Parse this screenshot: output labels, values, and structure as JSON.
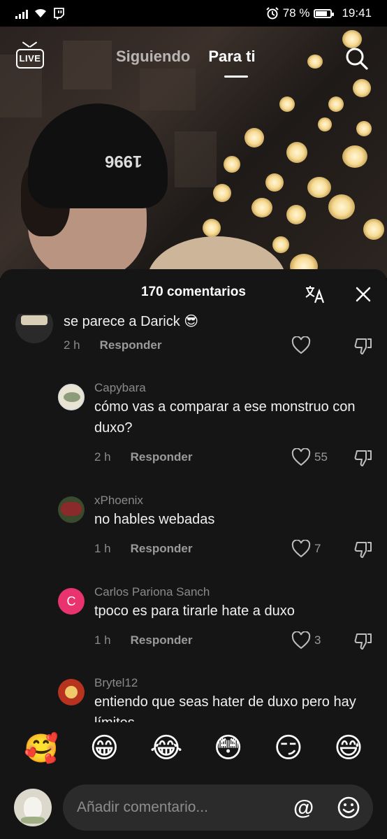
{
  "status_bar": {
    "battery": "78 %",
    "time": "19:41",
    "battery_level": 0.78
  },
  "top_nav": {
    "live_label": "LIVE",
    "tabs": [
      {
        "label": "Siguiendo",
        "active": false
      },
      {
        "label": "Para ti",
        "active": true
      }
    ]
  },
  "video": {
    "hat_text": "1996"
  },
  "comments_panel": {
    "title": "170 comentarios",
    "comments": [
      {
        "user": "",
        "text": "se parece a Darick 😎",
        "time": "2 h",
        "reply": "Responder",
        "likes": ""
      },
      {
        "user": "Capybara",
        "text": "cómo vas a comparar a ese monstruo con duxo?",
        "time": "2 h",
        "reply": "Responder",
        "likes": "55"
      },
      {
        "user": "xPhoenix",
        "text": "no hables webadas",
        "time": "1 h",
        "reply": "Responder",
        "likes": "7"
      },
      {
        "user": "Carlos Pariona Sanch",
        "text": "tpoco es para tirarle hate a duxo",
        "time": "1 h",
        "reply": "Responder",
        "likes": "3",
        "avatar_letter": "C"
      },
      {
        "user": "Brytel12",
        "text": "entiendo que seas hater de duxo pero hay límites",
        "time": "",
        "reply": "",
        "likes": ""
      }
    ]
  },
  "emoji_bar": [
    "🥰",
    "😁",
    "😂",
    "😳",
    "😏",
    "😅"
  ],
  "composer": {
    "placeholder": "Añadir comentario...",
    "mention_symbol": "@"
  },
  "colors": {
    "sheet_bg": "#151515",
    "input_bg": "#2b2b2b",
    "avatar_c": "#e8336f"
  }
}
